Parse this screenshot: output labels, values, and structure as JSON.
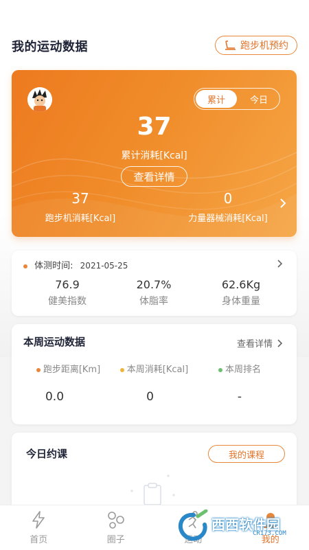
{
  "header": {
    "title": "我的运动数据",
    "book_button": "跑步机预约"
  },
  "hero": {
    "segment": {
      "active": "累计",
      "inactive": "今日"
    },
    "total_value": "37",
    "total_label": "累计消耗[Kcal]",
    "detail_button": "查看详情",
    "stats": [
      {
        "value": "37",
        "label": "跑步机消耗[Kcal]"
      },
      {
        "value": "0",
        "label": "力量器械消耗[Kcal]"
      }
    ]
  },
  "body_test": {
    "label": "体测时间:",
    "date": "2021-05-25",
    "stats": [
      {
        "value": "76.9",
        "label": "健美指数"
      },
      {
        "value": "20.7%",
        "label": "体脂率"
      },
      {
        "value": "62.6Kg",
        "label": "身体重量"
      }
    ]
  },
  "weekly": {
    "title": "本周运动数据",
    "more": "查看详情",
    "stats": [
      {
        "label": "跑步距离[Km]",
        "value": "0.0",
        "dot_color": "#e8873b"
      },
      {
        "label": "本周消耗[Kcal]",
        "value": "0",
        "dot_color": "#f0b43a"
      },
      {
        "label": "本周排名",
        "value": "-",
        "dot_color": "#6cc070"
      }
    ]
  },
  "today_course": {
    "title": "今日约课",
    "button": "我的课程"
  },
  "tabbar": [
    {
      "label": "首页",
      "icon": "lightning-icon"
    },
    {
      "label": "圈子",
      "icon": "circles-icon"
    },
    {
      "label": "运动",
      "icon": "runner-icon"
    },
    {
      "label": "我的",
      "icon": "profile-icon"
    }
  ],
  "watermark": {
    "text": "西西软件园",
    "sub": "CR173.COM"
  },
  "colors": {
    "accent": "#e2742a",
    "hero_start": "#ed7a1f",
    "hero_end": "#f6a646"
  }
}
